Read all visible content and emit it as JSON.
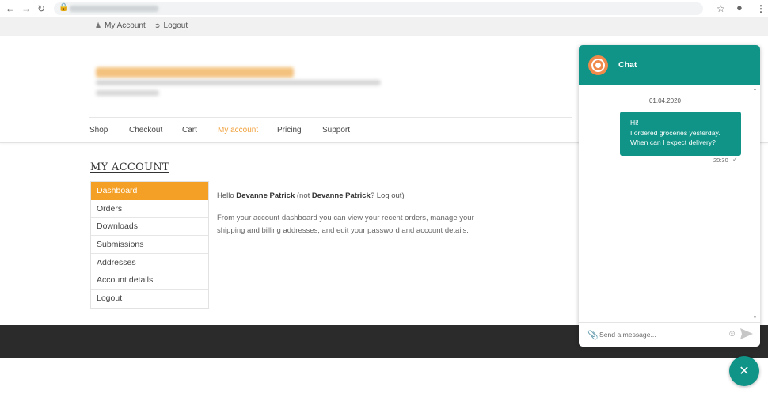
{
  "browser": {
    "back_icon": "arrow-left-icon",
    "forward_icon": "arrow-right-icon",
    "reload_icon": "reload-icon",
    "bookmark_icon": "star-icon",
    "profile_icon": "account-circle-icon",
    "menu_icon": "kebab-menu-icon"
  },
  "topbar": {
    "my_account": "My Account",
    "logout": "Logout"
  },
  "nav": {
    "items": [
      "Shop",
      "Checkout",
      "Cart",
      "My account",
      "Pricing",
      "Support"
    ],
    "active": "My account"
  },
  "page": {
    "title": "MY ACCOUNT",
    "menu": [
      "Dashboard",
      "Orders",
      "Downloads",
      "Submissions",
      "Addresses",
      "Account details",
      "Logout"
    ],
    "active_menu": "Dashboard",
    "hello_prefix": "Hello ",
    "user_name": "Devanne Patrick",
    "hello_mid": " (not ",
    "user_name_2": "Devanne Patrick",
    "hello_suffix": "? Log out)",
    "description": "From your account dashboard you can view your recent orders, manage your shipping and billing addresses, and edit your password and account details."
  },
  "chat": {
    "title": "Chat",
    "date": "01.04.2020",
    "message_lines": [
      "Hi!",
      "I ordered groceries yesterday.",
      "When can I expect delivery?"
    ],
    "message_time": "20:30",
    "input_placeholder": "Send a message...",
    "fab_icon": "close-icon"
  },
  "colors": {
    "accent_orange": "#f4a027",
    "chat_teal": "#119488",
    "footer": "#2b2b2b"
  }
}
